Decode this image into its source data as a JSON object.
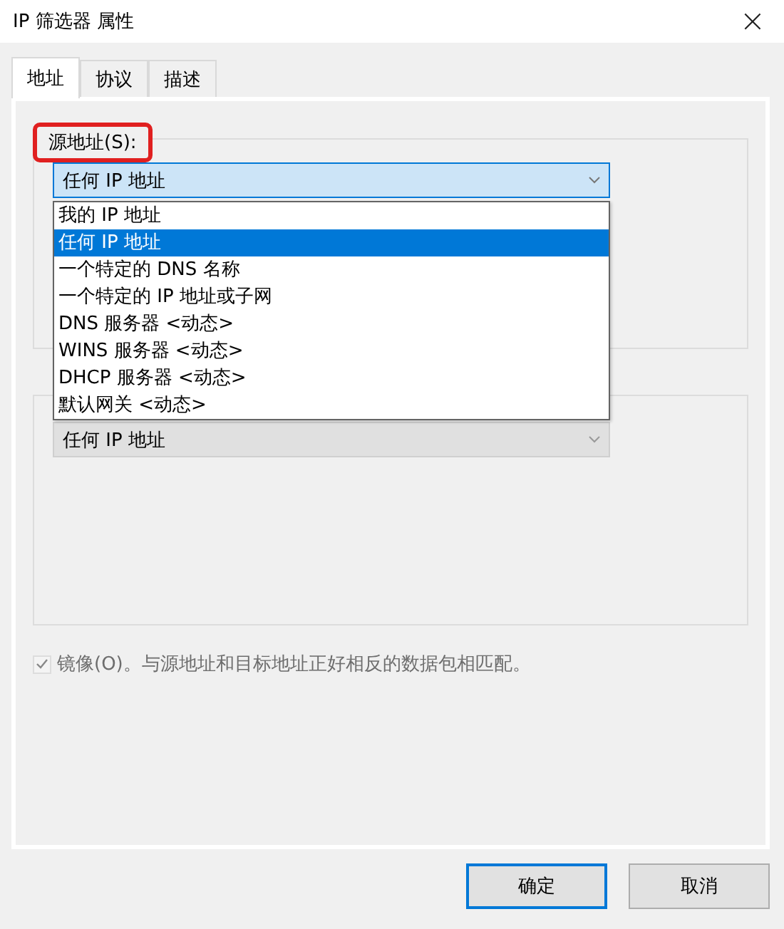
{
  "window": {
    "title": "IP 筛选器 属性",
    "close": "×"
  },
  "tabs": [
    {
      "label": "地址",
      "selected": true
    },
    {
      "label": "协议",
      "selected": false
    },
    {
      "label": "描述",
      "selected": false
    }
  ],
  "source": {
    "label": "源地址(S):",
    "highlighted": true,
    "value": "任何 IP 地址",
    "expanded": true,
    "options": [
      {
        "label": "我的 IP 地址",
        "selected": false
      },
      {
        "label": "任何 IP 地址",
        "selected": true
      },
      {
        "label": "一个特定的 DNS 名称",
        "selected": false
      },
      {
        "label": "一个特定的 IP 地址或子网",
        "selected": false
      },
      {
        "label": "DNS 服务器 <动态>",
        "selected": false
      },
      {
        "label": "WINS 服务器 <动态>",
        "selected": false
      },
      {
        "label": "DHCP 服务器 <动态>",
        "selected": false
      },
      {
        "label": "默认网关 <动态>",
        "selected": false
      }
    ]
  },
  "destination": {
    "value": "任何 IP 地址",
    "disabled": true
  },
  "mirror": {
    "label": "镜像(O)。与源地址和目标地址正好相反的数据包相匹配。",
    "checked": true,
    "disabled": true
  },
  "buttons": [
    {
      "label": "确定",
      "default": true
    },
    {
      "label": "取消",
      "default": false
    }
  ]
}
